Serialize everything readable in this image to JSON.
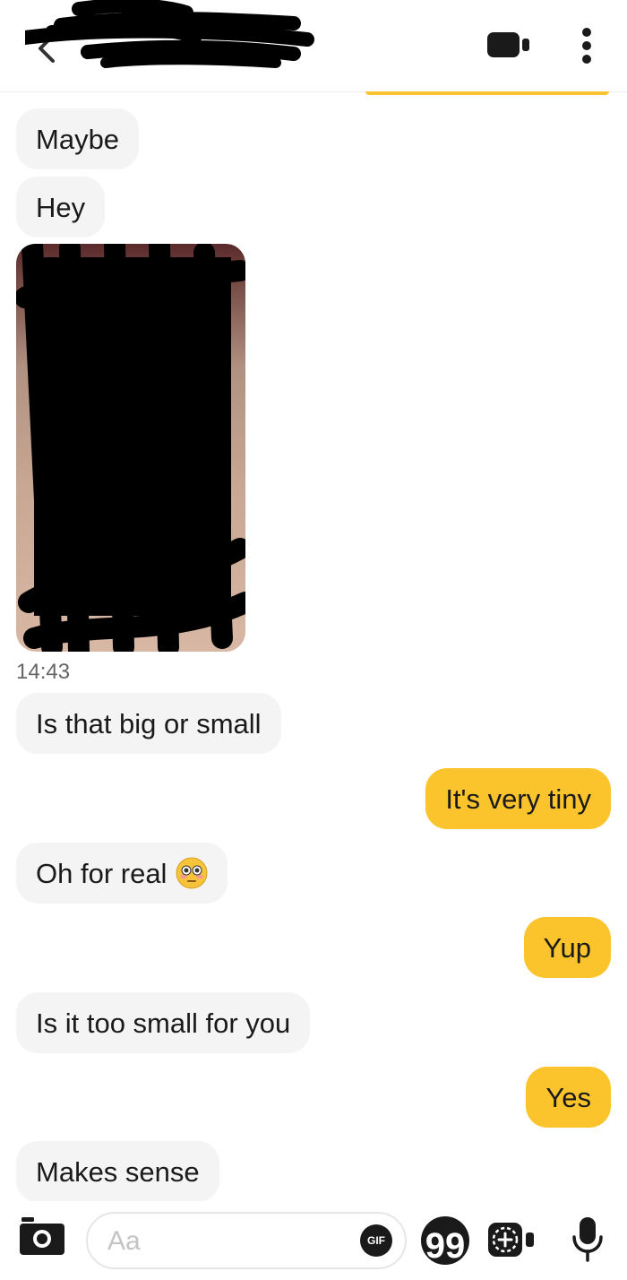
{
  "header": {
    "back_icon": "chevron-left-icon",
    "video_icon": "video-camera-icon",
    "more_icon": "more-vertical-icon"
  },
  "messages": [
    {
      "side": "in",
      "text": "Maybe"
    },
    {
      "side": "in",
      "text": "Hey"
    },
    {
      "side": "in",
      "type": "image"
    },
    {
      "side": "in",
      "text": "Is that big or small"
    },
    {
      "side": "out",
      "text": "It's very tiny"
    },
    {
      "side": "in",
      "text": "Oh for real",
      "emoji": "flushed-face"
    },
    {
      "side": "out",
      "text": "Yup"
    },
    {
      "side": "in",
      "text": "Is it too small for you"
    },
    {
      "side": "out",
      "text": "Yes"
    },
    {
      "side": "in",
      "text": "Makes sense"
    }
  ],
  "image_timestamp": "14:43",
  "composer": {
    "placeholder": "Aa",
    "gif_label": "GIF",
    "quote_label": "99"
  },
  "colors": {
    "accent": "#fbc42d",
    "incoming_bubble": "#f4f4f4"
  }
}
